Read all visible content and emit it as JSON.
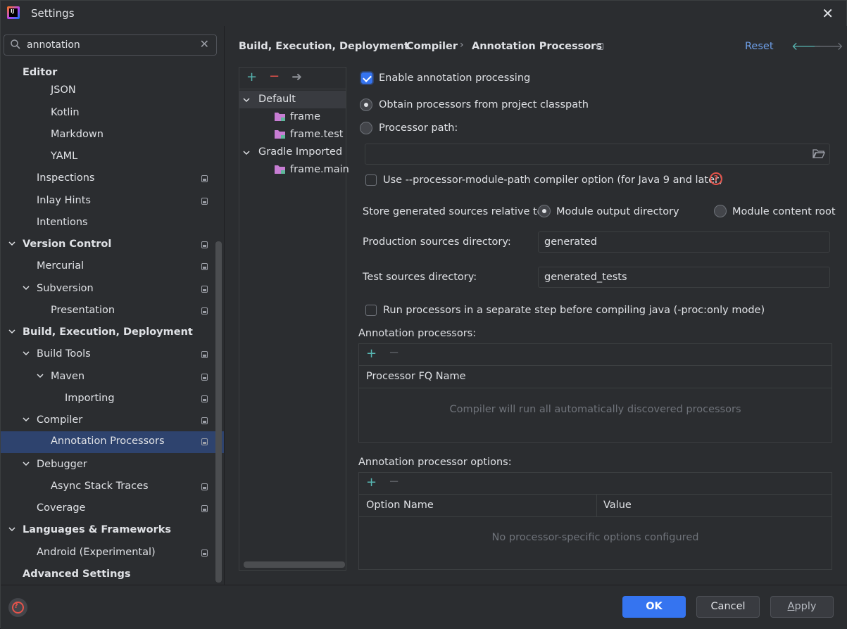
{
  "window": {
    "title": "Settings"
  },
  "search": {
    "value": "annotation",
    "placeholder": ""
  },
  "tree": [
    {
      "label": "Editor",
      "bold": true
    },
    {
      "label": "JSON"
    },
    {
      "label": "Kotlin"
    },
    {
      "label": "Markdown"
    },
    {
      "label": "YAML"
    },
    {
      "label": "Inspections"
    },
    {
      "label": "Inlay Hints"
    },
    {
      "label": "Intentions"
    },
    {
      "label": "Version Control",
      "bold": true
    },
    {
      "label": "Mercurial"
    },
    {
      "label": "Subversion"
    },
    {
      "label": "Presentation"
    },
    {
      "label": "Build, Execution, Deployment",
      "bold": true
    },
    {
      "label": "Build Tools"
    },
    {
      "label": "Maven"
    },
    {
      "label": "Importing"
    },
    {
      "label": "Compiler"
    },
    {
      "label": "Annotation Processors",
      "selected": true
    },
    {
      "label": "Debugger"
    },
    {
      "label": "Async Stack Traces"
    },
    {
      "label": "Coverage"
    },
    {
      "label": "Languages & Frameworks",
      "bold": true
    },
    {
      "label": "Android (Experimental)"
    },
    {
      "label": "Advanced Settings",
      "bold": true
    }
  ],
  "breadcrumb": {
    "items": [
      "Build, Execution, Deployment",
      "Compiler",
      "Annotation Processors"
    ],
    "separator": "›"
  },
  "header": {
    "reset": "Reset"
  },
  "profiles": {
    "items": [
      {
        "label": "Default"
      },
      {
        "label": "frame"
      },
      {
        "label": "frame.test"
      },
      {
        "label": "Gradle Imported"
      },
      {
        "label": "frame.main"
      }
    ]
  },
  "options": {
    "enable_processing": {
      "label": "Enable annotation processing",
      "checked": true
    },
    "obtain_from_classpath": {
      "label": "Obtain processors from project classpath",
      "selected": true
    },
    "processor_path": {
      "label": "Processor path:",
      "selected": false,
      "value": ""
    },
    "module_path": {
      "label": "Use --processor-module-path compiler option (for Java 9 and later)",
      "checked": false
    },
    "store_relative": {
      "label": "Store generated sources relative to:",
      "module_output": "Module output directory",
      "module_content": "Module content root",
      "selected": "Module output directory"
    },
    "production_dir": {
      "label": "Production sources directory:",
      "value": "generated"
    },
    "test_dir": {
      "label": "Test sources directory:",
      "value": "generated_tests"
    },
    "separate_step": {
      "label": "Run processors in a separate step before compiling java (-proc:only mode)",
      "checked": false
    }
  },
  "processors_table": {
    "title": "Annotation processors:",
    "column": "Processor FQ Name",
    "empty": "Compiler will run all automatically discovered processors"
  },
  "options_table": {
    "title": "Annotation processor options:",
    "columns": [
      "Option Name",
      "Value"
    ],
    "empty": "No processor-specific options configured"
  },
  "buttons": {
    "ok": "OK",
    "cancel": "Cancel",
    "apply_first": "A",
    "apply_rest": "pply"
  },
  "colors": {
    "accent": "#3574f0",
    "selection": "#2e436e",
    "link": "#6e9fe8",
    "add": "#57b6b2",
    "remove": "#e5534b",
    "folder": "#c77dd3"
  }
}
